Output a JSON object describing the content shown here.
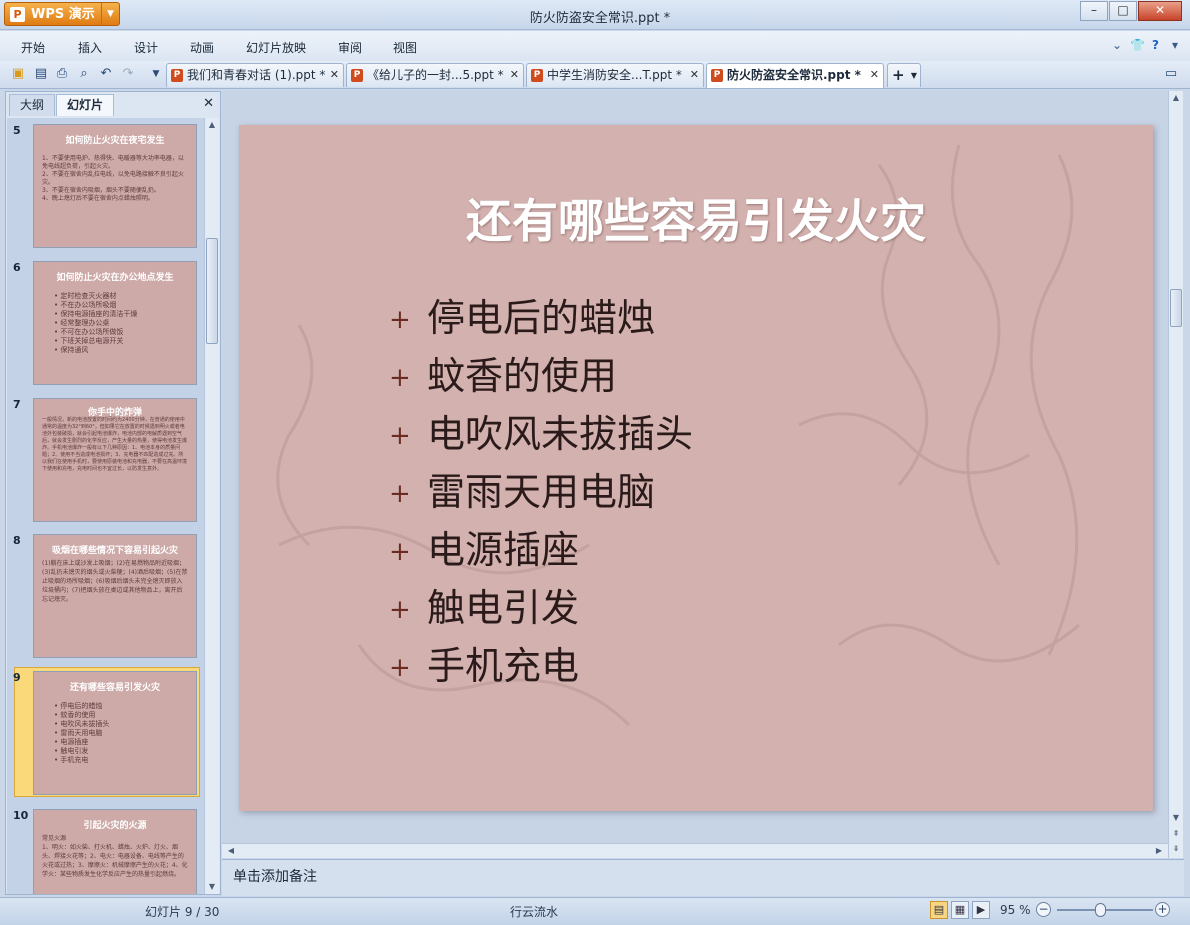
{
  "app": {
    "name": "WPS 演示",
    "doc_title": "防火防盗安全常识.ppt *"
  },
  "menu": [
    "开始",
    "插入",
    "设计",
    "动画",
    "幻灯片放映",
    "审阅",
    "视图"
  ],
  "tabs": [
    {
      "label": "我们和青春对话 (1).ppt *",
      "active": false
    },
    {
      "label": "《给儿子的一封...5.ppt *",
      "active": false
    },
    {
      "label": "中学生消防安全...T.ppt *",
      "active": false
    },
    {
      "label": "防火防盗安全常识.ppt *",
      "active": true
    }
  ],
  "panel": {
    "tab_outline": "大纲",
    "tab_slides": "幻灯片"
  },
  "thumbs": [
    {
      "num": "5",
      "title": "如何防止火灾在夜宅发生",
      "lines": [
        "1、不要使用电炉、热得快、电暖器等大功率电器，以免电线超负荷，引起火灾。",
        "2、不要在宿舍内乱拉电线，以免电路接触不良引起火灾。",
        "3、不要在宿舍内吸烟，烟头不要随便乱扔。",
        "4、晚上熄灯后不要在宿舍内点蜡烛照明。"
      ]
    },
    {
      "num": "6",
      "title": "如何防止火灾在办公地点发生",
      "lines": [
        "定时检查灭火器材",
        "不在办公场所吸烟",
        "保持电源插座的清洁干燥",
        "经常整理办公桌",
        "不可在办公场所做饭",
        "下班关掉总电源开关",
        "保持通风"
      ]
    },
    {
      "num": "7",
      "title": "你手中的炸弹",
      "lines": [
        "一般情况，新的电池放置的时间约为2400分钟，在普通的使用中通常的温度为32°到60°，但如果它在放置的时候遇到明火或者电池外包装破损，就会引起电池爆炸，电池内部的电解质遇到空气后，就会发生剧烈的化学反应，产生大量的热量，使得电池发生爆炸。手机电池爆炸一般有以下几种原因：1、电池本身的质量问题；2、使用不当造成电池损坏；3、充电器不匹配造成过充。所以我们在使用手机时，要使用原装电池和充电器，不要在高温环境下使用和充电，充电时间也不宜过长，以防发生意外。"
      ]
    },
    {
      "num": "8",
      "title": "吸烟在哪些情况下容易引起火灾",
      "lines": [
        "(1)躺在床上或沙发上吸烟；(2)在易燃物品附近吸烟；(3)乱扔未熄灭的烟头或火柴梗；(4)酒后吸烟；(5)在禁止吸烟的场所吸烟；(6)吸烟后烟头未完全熄灭即放入垃圾桶内；(7)把烟头放在桌边或其他物品上，离开后忘记熄灭。"
      ]
    },
    {
      "num": "9",
      "title": "还有哪些容易引发火灾",
      "lines": [
        "停电后的蜡烛",
        "蚊香的使用",
        "电吹风未拔插头",
        "雷雨天用电脑",
        "电源插座",
        "触电引发",
        "手机充电"
      ]
    },
    {
      "num": "10",
      "title": "引起火灾的火源",
      "lines": [
        "常见火源",
        "1、明火：如火柴、打火机、蜡烛、火炉、灯火、烟头、焊接火花等；2、电火：电器设备、电线等产生的火花或过热；3、摩擦火：机械摩擦产生的火花；4、化学火：某些物质发生化学反应产生的热量引起燃烧。"
      ]
    }
  ],
  "slide": {
    "title": "还有哪些容易引发火灾",
    "bullet_symbol": "+",
    "bullets": [
      "停电后的蜡烛",
      "蚊香的使用",
      "电吹风未拔插头",
      "雷雨天用电脑",
      "电源插座",
      "触电引发",
      "手机充电"
    ]
  },
  "notes_placeholder": "单击添加备注",
  "status": {
    "slide_pos": "幻灯片 9 / 30",
    "theme": "行云流水",
    "zoom": "95 %"
  },
  "colors": {
    "accent_orange": "#e58a1f",
    "slide_bg": "#d2b1af",
    "selected_thumb": "#f9d97a"
  }
}
